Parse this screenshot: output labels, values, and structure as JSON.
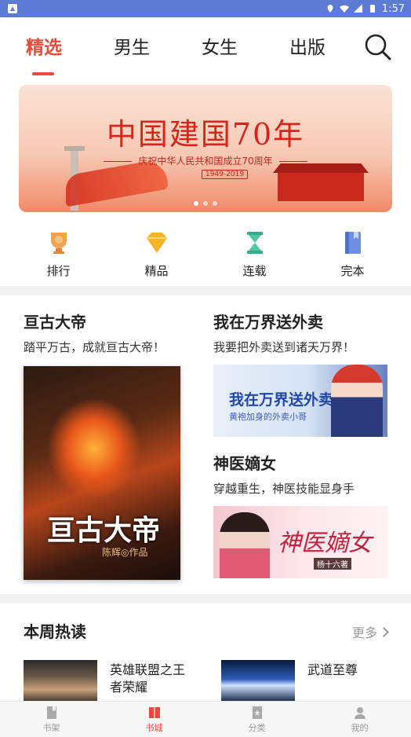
{
  "status_bar": {
    "time": "1:57"
  },
  "tabs": [
    {
      "label": "精选",
      "active": true
    },
    {
      "label": "男生",
      "active": false
    },
    {
      "label": "女生",
      "active": false
    },
    {
      "label": "出版",
      "active": false
    }
  ],
  "banner": {
    "title": "中国建国70年",
    "subtitle": "庆祝中华人民共和国成立70周年",
    "date": "1949-2019"
  },
  "categories": [
    {
      "label": "排行",
      "icon": "trophy-icon"
    },
    {
      "label": "精品",
      "icon": "diamond-icon"
    },
    {
      "label": "连载",
      "icon": "hourglass-icon"
    },
    {
      "label": "完本",
      "icon": "book-icon"
    }
  ],
  "featured": {
    "big": {
      "title": "亘古大帝",
      "desc": "踏平万古，成就亘古大帝！",
      "cover_title": "亘古大帝",
      "cover_author": "陈辉◎作品"
    },
    "item2": {
      "title": "我在万界送外卖",
      "desc": "我要把外卖送到诸天万界！",
      "cover_title": "我在万界送外卖",
      "cover_sub": "黄袍加身的外卖小哥"
    },
    "item3": {
      "title": "神医嫡女",
      "desc": "穿越重生，神医技能显身手",
      "cover_title": "神医嫡女",
      "cover_author": "杨十六著"
    }
  },
  "weekly": {
    "header": "本周热读",
    "more": "更多",
    "items": [
      {
        "name": "英雄联盟之王者荣耀"
      },
      {
        "name": "武道至尊"
      }
    ]
  },
  "bottom_nav": [
    {
      "label": "书架",
      "active": false
    },
    {
      "label": "书城",
      "active": true
    },
    {
      "label": "分类",
      "active": false
    },
    {
      "label": "我的",
      "active": false
    }
  ],
  "colors": {
    "accent": "#e84a3b",
    "status_bar": "#5b7bd5"
  }
}
